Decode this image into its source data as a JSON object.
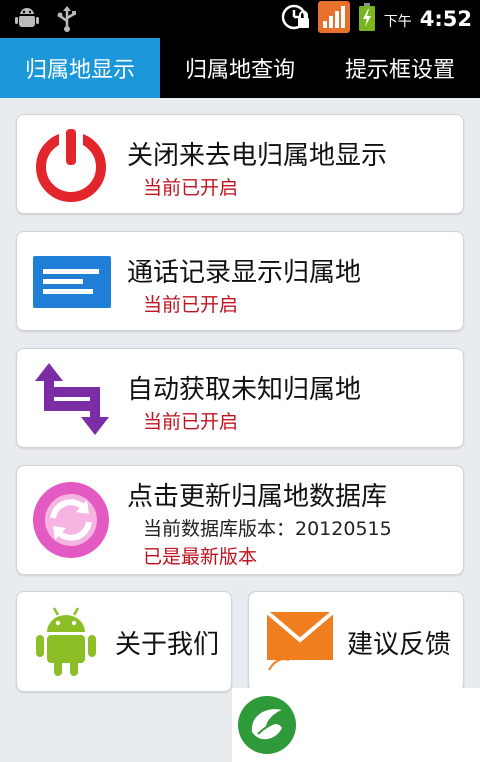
{
  "status_bar": {
    "icons_left": [
      "android-debug-icon",
      "usb-icon"
    ],
    "icons_right": [
      "alarm-lock-icon",
      "signal-app-icon",
      "battery-charging-icon"
    ],
    "ampm": "下午",
    "time": "4:52"
  },
  "tabs": [
    {
      "label": "归属地显示",
      "active": true
    },
    {
      "label": "归属地查询",
      "active": false
    },
    {
      "label": "提示框设置",
      "active": false
    }
  ],
  "cards": [
    {
      "title": "关闭来去电归属地显示",
      "status": "当前已开启",
      "icon": "power-icon",
      "color": "#e3262b"
    },
    {
      "title": "通话记录显示归属地",
      "status": "当前已开启",
      "icon": "list-icon",
      "color": "#1f7fd6"
    },
    {
      "title": "自动获取未知归属地",
      "status": "当前已开启",
      "icon": "sync-arrows-icon",
      "color": "#7b2da6"
    },
    {
      "title": "点击更新归属地数据库",
      "version": "当前数据库版本：20120515",
      "status": "已是最新版本",
      "icon": "refresh-icon",
      "color": "#e45ac3"
    }
  ],
  "bottom_buttons": [
    {
      "label": "关于我们",
      "icon": "android-robot-icon",
      "color": "#8cbf26"
    },
    {
      "label": "建议反馈",
      "icon": "mail-envelope-icon",
      "color": "#f07d1e"
    }
  ],
  "watermark_icon": "leaf-logo-icon",
  "colors": {
    "tab_active": "#1c98da",
    "status_red": "#c1121f",
    "background": "#e9ecef"
  }
}
